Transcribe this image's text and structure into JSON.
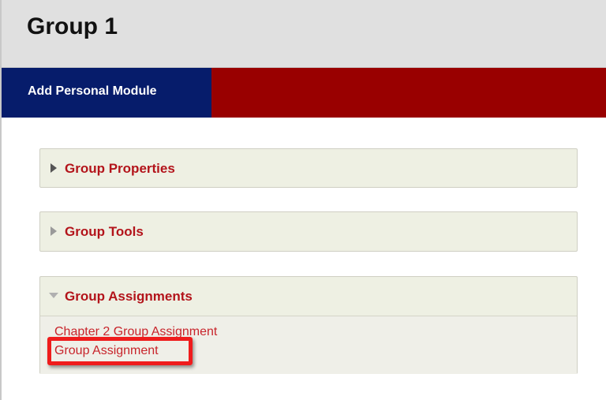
{
  "page": {
    "title": "Group 1"
  },
  "nav": {
    "tab_label": "Add Personal Module"
  },
  "modules": [
    {
      "label": "Group Properties",
      "state": "collapsed",
      "icon": "triangle-right-icon"
    },
    {
      "label": "Group Tools",
      "state": "collapsed",
      "icon": "triangle-right-icon"
    },
    {
      "label": "Group Assignments",
      "state": "expanded",
      "icon": "triangle-down-icon",
      "links": [
        "Chapter 2 Group Assignment",
        "Group Assignment"
      ]
    }
  ],
  "colors": {
    "nav_bar": "#990000",
    "nav_tab": "#061c6b",
    "module_title": "#b3141b",
    "highlight": "#ef1c1c"
  }
}
